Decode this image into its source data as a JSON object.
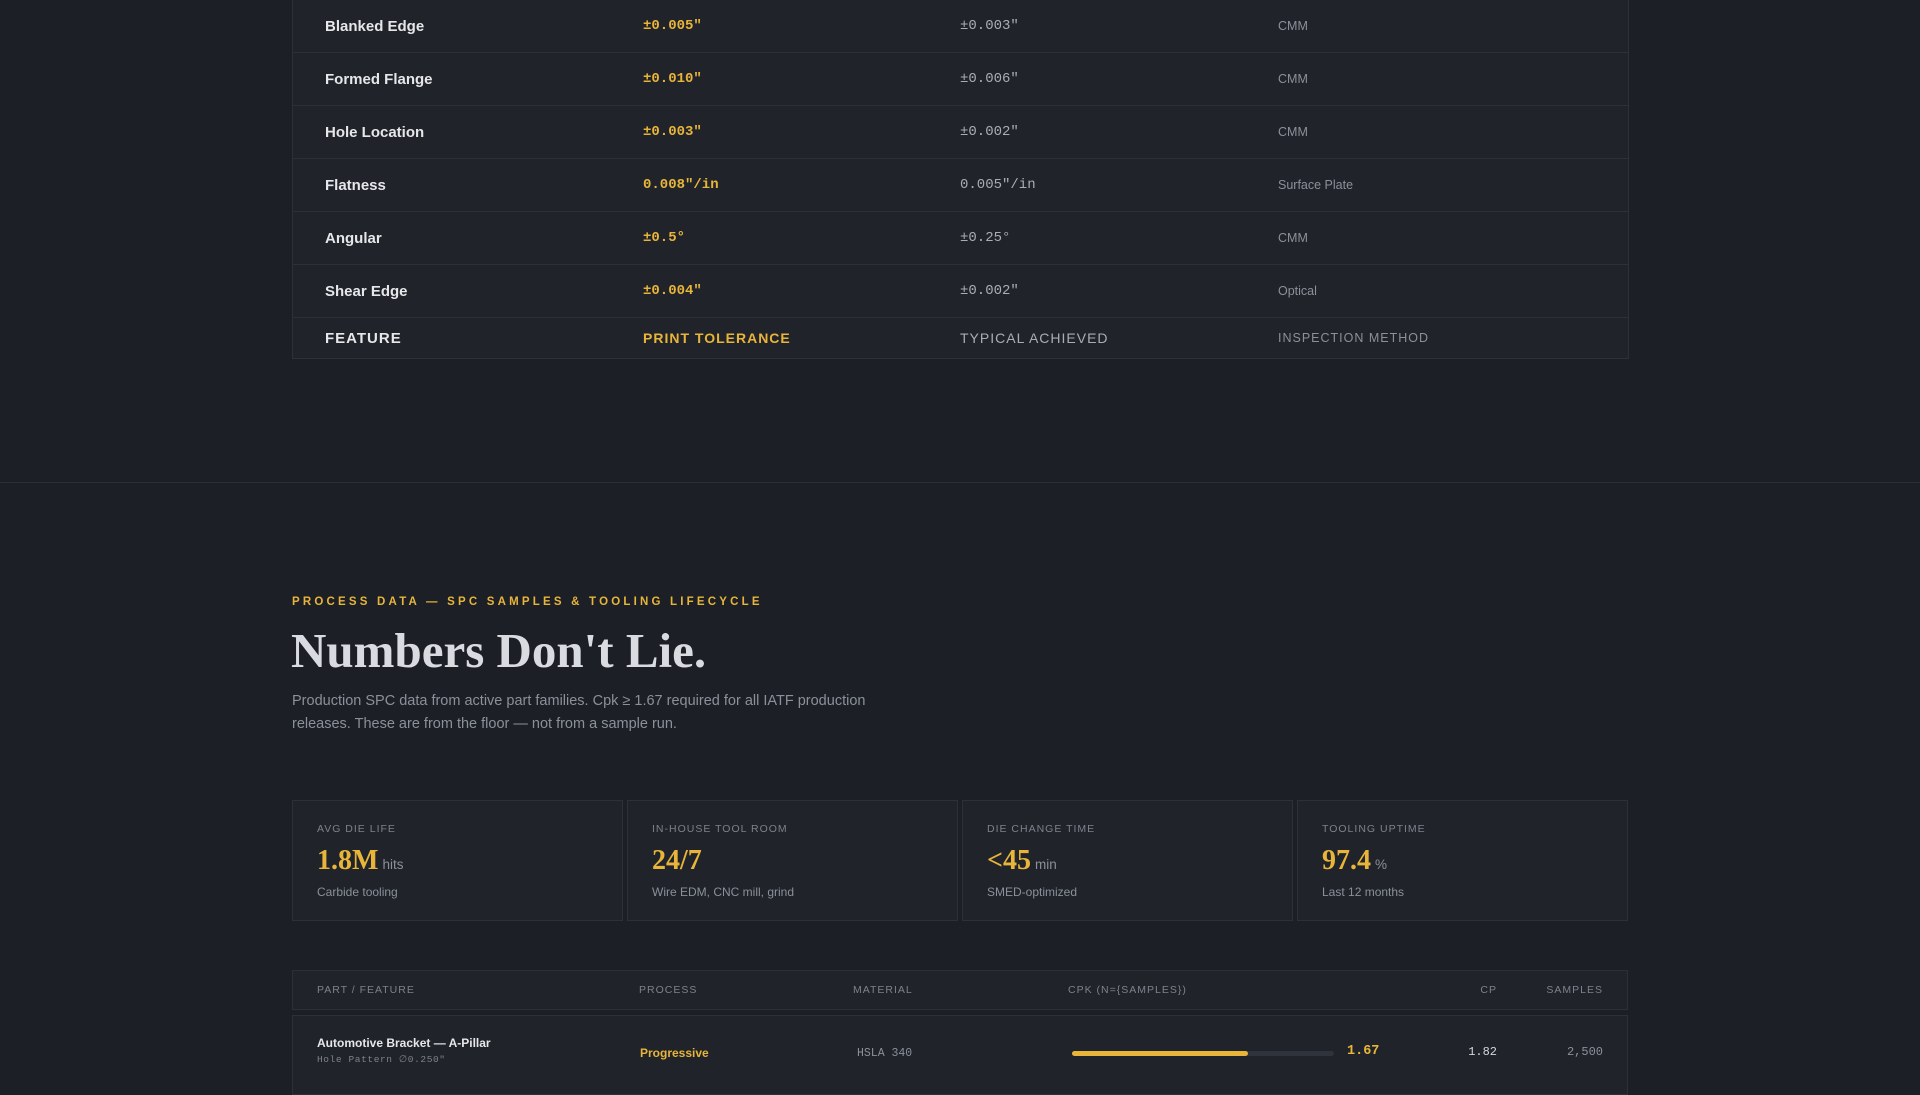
{
  "tolerance_table": {
    "rows": [
      {
        "feature": "Blanked Edge",
        "print_tolerance": "±0.005\"",
        "typical": "±0.003\"",
        "method": "CMM"
      },
      {
        "feature": "Formed Flange",
        "print_tolerance": "±0.010\"",
        "typical": "±0.006\"",
        "method": "CMM"
      },
      {
        "feature": "Hole Location",
        "print_tolerance": "±0.003\"",
        "typical": "±0.002\"",
        "method": "CMM"
      },
      {
        "feature": "Flatness",
        "print_tolerance": "0.008\"/in",
        "typical": "0.005\"/in",
        "method": "Surface Plate"
      },
      {
        "feature": "Angular",
        "print_tolerance": "±0.5°",
        "typical": "±0.25°",
        "method": "CMM"
      },
      {
        "feature": "Shear Edge",
        "print_tolerance": "±0.004\"",
        "typical": "±0.002\"",
        "method": "Optical"
      }
    ],
    "footer": {
      "feature": "FEATURE",
      "print_tolerance": "PRINT TOLERANCE",
      "typical": "TYPICAL ACHIEVED",
      "method": "INSPECTION METHOD"
    }
  },
  "process": {
    "eyebrow": "PROCESS DATA — SPC SAMPLES & TOOLING LIFECYCLE",
    "title": "Numbers Don't Lie.",
    "subtitle": "Production SPC data from active part families. Cpk ≥ 1.67 required for all IATF production releases. These are from the floor — not from a sample run."
  },
  "stats": [
    {
      "label": "AVG DIE LIFE",
      "value": "1.8M",
      "unit": "hits",
      "note": "Carbide tooling"
    },
    {
      "label": "IN-HOUSE TOOL ROOM",
      "value": "24/7",
      "unit": "",
      "note": "Wire EDM, CNC mill, grind"
    },
    {
      "label": "DIE CHANGE TIME",
      "value": "<45",
      "unit": "min",
      "note": "SMED-optimized"
    },
    {
      "label": "TOOLING UPTIME",
      "value": "97.4",
      "unit": "%",
      "note": "Last 12 months"
    }
  ],
  "spc_table": {
    "headers": {
      "part": "PART / FEATURE",
      "process": "PROCESS",
      "material": "MATERIAL",
      "cpk": "CPK (N={SAMPLES})",
      "cp": "CP",
      "samples": "SAMPLES"
    },
    "rows": [
      {
        "part": "Automotive Bracket — A-Pillar",
        "feature": "Hole Pattern ∅0.250\"",
        "process": "Progressive",
        "material": "HSLA 340",
        "cpk": "1.67",
        "cpk_bar_fraction": 0.67,
        "cp": "1.82",
        "samples": "2,500"
      }
    ]
  },
  "colors": {
    "background": "#1c1f26",
    "accent": "#e8b53a",
    "panel": "#20232a",
    "border": "#2c3039"
  }
}
